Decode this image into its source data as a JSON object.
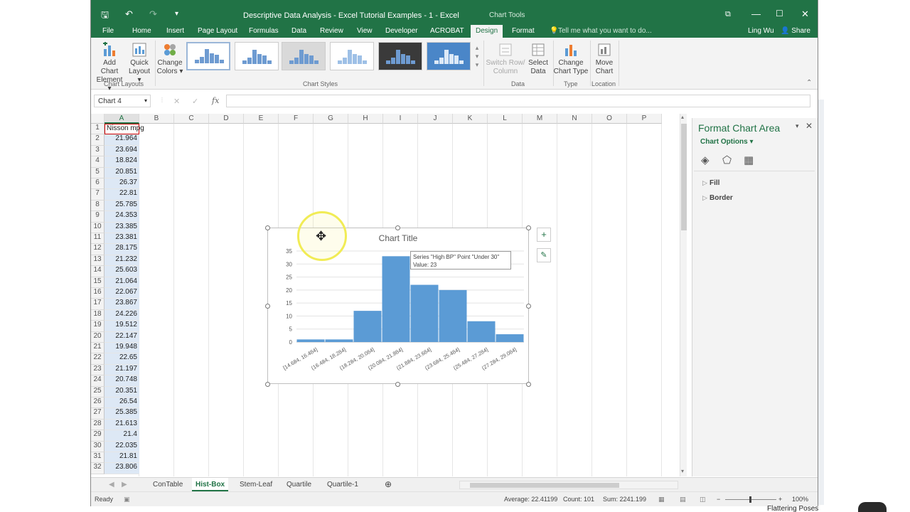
{
  "window": {
    "title": "Descriptive Data Analysis - Excel Tutorial Examples - 1 - Excel",
    "context_title": "Chart Tools",
    "accent_color": "#217346"
  },
  "tabs": [
    "File",
    "Home",
    "Insert",
    "Page Layout",
    "Formulas",
    "Data",
    "Review",
    "View",
    "Developer",
    "ACROBAT",
    "Design",
    "Format"
  ],
  "active_tab": "Design",
  "tell_me": "Tell me what you want to do...",
  "user": "Ling Wu",
  "share": "Share",
  "ribbon": {
    "add_chart_element": [
      "Add Chart",
      "Element"
    ],
    "quick_layout": [
      "Quick",
      "Layout"
    ],
    "change_colors": [
      "Change",
      "Colors"
    ],
    "switch_row_column": [
      "Switch Row/",
      "Column"
    ],
    "select_data": [
      "Select",
      "Data"
    ],
    "change_chart_type": [
      "Change",
      "Chart Type"
    ],
    "move_chart": [
      "Move",
      "Chart"
    ],
    "groups": {
      "chart_layouts": "Chart Layouts",
      "chart_styles": "Chart Styles",
      "data": "Data",
      "type": "Type",
      "location": "Location"
    }
  },
  "formula_bar": {
    "name_box": "Chart 4",
    "fx": "fx",
    "cancel": "✕",
    "enter": "✓"
  },
  "columns": [
    "A",
    "B",
    "C",
    "D",
    "E",
    "F",
    "G",
    "H",
    "I",
    "J",
    "K",
    "L",
    "M",
    "N",
    "O",
    "P"
  ],
  "rows": [
    {
      "n": "1",
      "a": "Nisson mpg"
    },
    {
      "n": "2",
      "a": "21.964"
    },
    {
      "n": "3",
      "a": "23.694"
    },
    {
      "n": "4",
      "a": "18.824"
    },
    {
      "n": "5",
      "a": "20.851"
    },
    {
      "n": "6",
      "a": "26.37"
    },
    {
      "n": "7",
      "a": "22.81"
    },
    {
      "n": "8",
      "a": "25.785"
    },
    {
      "n": "9",
      "a": "24.353"
    },
    {
      "n": "10",
      "a": "23.385"
    },
    {
      "n": "11",
      "a": "23.381"
    },
    {
      "n": "12",
      "a": "28.175"
    },
    {
      "n": "13",
      "a": "21.232"
    },
    {
      "n": "14",
      "a": "25.603"
    },
    {
      "n": "15",
      "a": "21.064"
    },
    {
      "n": "16",
      "a": "22.067"
    },
    {
      "n": "17",
      "a": "23.867"
    },
    {
      "n": "18",
      "a": "24.226"
    },
    {
      "n": "19",
      "a": "19.512"
    },
    {
      "n": "20",
      "a": "22.147"
    },
    {
      "n": "21",
      "a": "19.948"
    },
    {
      "n": "22",
      "a": "22.65"
    },
    {
      "n": "23",
      "a": "21.197"
    },
    {
      "n": "24",
      "a": "20.748"
    },
    {
      "n": "25",
      "a": "20.351"
    },
    {
      "n": "26",
      "a": "26.54"
    },
    {
      "n": "27",
      "a": "25.385"
    },
    {
      "n": "28",
      "a": "21.613"
    },
    {
      "n": "29",
      "a": "21.4"
    },
    {
      "n": "30",
      "a": "22.035"
    },
    {
      "n": "31",
      "a": "21.81"
    },
    {
      "n": "32",
      "a": "23.806"
    }
  ],
  "chart_data": {
    "type": "bar",
    "title": "Chart Title",
    "categories": [
      "[14.684, 16.484]",
      "(16.484, 18.284]",
      "(18.284, 20.084]",
      "(20.084, 21.884]",
      "(21.884, 23.684]",
      "(23.684, 25.484]",
      "(25.484, 27.284]",
      "(27.284, 29.084]"
    ],
    "values": [
      1,
      1,
      12,
      33,
      22,
      20,
      8,
      3
    ],
    "ylim": [
      0,
      35
    ],
    "yticks": [
      0,
      5,
      10,
      15,
      20,
      25,
      30,
      35
    ],
    "bar_color": "#5b9bd5",
    "grid": true,
    "tooltip": [
      "Series \"High BP\" Point \"Under 30\"",
      "Value: 23"
    ]
  },
  "format_pane": {
    "title": "Format Chart Area",
    "options": "Chart Options",
    "sections": [
      "Fill",
      "Border"
    ]
  },
  "sheets": [
    "ConTable",
    "Hist-Box",
    "Stem-Leaf",
    "Quartile",
    "Quartile-1"
  ],
  "active_sheet": "Hist-Box",
  "status": {
    "ready": "Ready",
    "average": "Average: 22.41199",
    "count": "Count: 101",
    "sum": "Sum: 2241.199",
    "zoom": "100%"
  },
  "outside_text": [
    "Flattering Poses"
  ]
}
